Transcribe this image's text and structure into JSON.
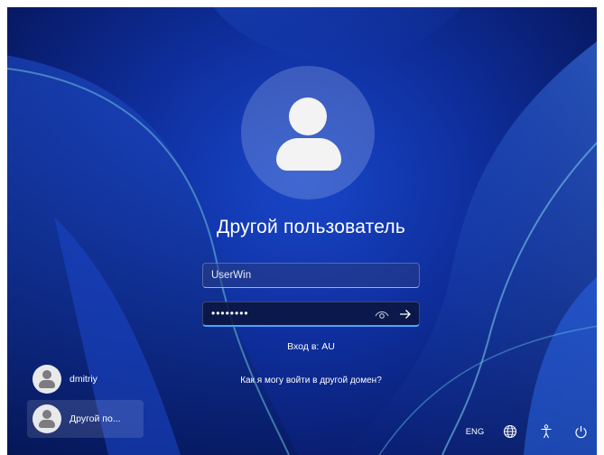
{
  "login": {
    "username_title": "Другой пользователь",
    "username_value": "UserWin",
    "password_mask": "••••••••",
    "sign_in_to": "Вход в: AU",
    "other_domain_link": "Как я могу войти в другой домен?"
  },
  "users": [
    {
      "label": "dmitriy",
      "active": false
    },
    {
      "label": "Другой по...",
      "active": true
    }
  ],
  "tray": {
    "language": "ENG",
    "network_icon": "globe-network-icon",
    "accessibility_icon": "accessibility-icon",
    "power_icon": "power-icon"
  },
  "colors": {
    "background": "#0f2f9e",
    "focus_accent": "#4aa3ff"
  }
}
